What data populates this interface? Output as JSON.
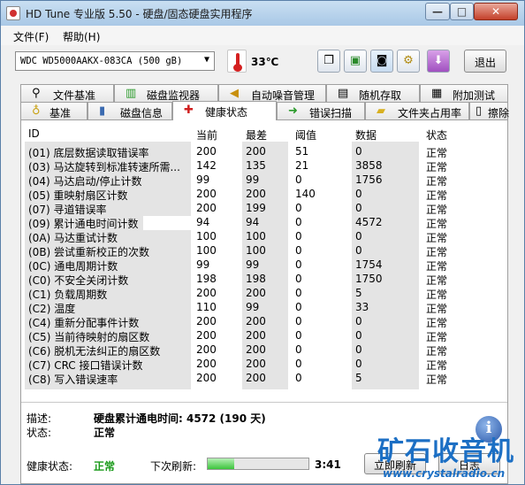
{
  "window": {
    "title": "HD Tune 专业版 5.50 - 硬盘/固态硬盘实用程序",
    "controls": {
      "minimize": "—",
      "maximize": "□",
      "close": "✕"
    }
  },
  "menu": {
    "file": "文件(F)",
    "help": "帮助(H)"
  },
  "toolbar": {
    "drive": "WDC WD5000AAKX-083CA (500 gB)",
    "temperature": "33℃",
    "exit_label": "退出",
    "icons": [
      "copy-text-icon",
      "copy-info-icon",
      "screenshot-camera-icon",
      "settings-tools-icon",
      "save-download-icon"
    ]
  },
  "tabs_top": [
    {
      "label": "文件基准",
      "icon": "file-benchmark-icon",
      "glyph": "⚲"
    },
    {
      "label": "磁盘监视器",
      "icon": "disk-monitor-icon",
      "glyph": "▥"
    },
    {
      "label": "自动噪音管理",
      "icon": "speaker-icon",
      "glyph": "◀"
    },
    {
      "label": "随机存取",
      "icon": "random-access-icon",
      "glyph": "▤"
    },
    {
      "label": "附加测试",
      "icon": "extra-tests-icon",
      "glyph": "▦"
    }
  ],
  "tabs_bottom": [
    {
      "label": "基准",
      "icon": "benchmark-icon",
      "glyph": "♁"
    },
    {
      "label": "磁盘信息",
      "icon": "disk-info-icon",
      "glyph": "▮"
    },
    {
      "label": "健康状态",
      "icon": "health-cross-icon",
      "glyph": "✚",
      "active": true
    },
    {
      "label": "错误扫描",
      "icon": "error-scan-icon",
      "glyph": "➜"
    },
    {
      "label": "文件夹占用率",
      "icon": "folder-usage-icon",
      "glyph": "▰"
    },
    {
      "label": "擦除",
      "icon": "erase-trash-icon",
      "glyph": "▯"
    }
  ],
  "table": {
    "headers": {
      "id": "ID",
      "current": "当前",
      "worst": "最差",
      "threshold": "阈值",
      "data": "数据",
      "status": "状态"
    },
    "rows": [
      {
        "id": "(01) 底层数据读取错误率",
        "current": "200",
        "worst": "200",
        "threshold": "51",
        "data": "0",
        "status": "正常"
      },
      {
        "id": "(03) 马达旋转到标准转速所需...",
        "current": "142",
        "worst": "135",
        "threshold": "21",
        "data": "3858",
        "status": "正常"
      },
      {
        "id": "(04) 马达启动/停止计数",
        "current": "99",
        "worst": "99",
        "threshold": "0",
        "data": "1756",
        "status": "正常"
      },
      {
        "id": "(05) 重映射扇区计数",
        "current": "200",
        "worst": "200",
        "threshold": "140",
        "data": "0",
        "status": "正常"
      },
      {
        "id": "(07) 寻道错误率",
        "current": "200",
        "worst": "199",
        "threshold": "0",
        "data": "0",
        "status": "正常"
      },
      {
        "id": "(09) 累计通电时间计数",
        "current": "94",
        "worst": "94",
        "threshold": "0",
        "data": "4572",
        "status": "正常"
      },
      {
        "id": "(0A) 马达重试计数",
        "current": "100",
        "worst": "100",
        "threshold": "0",
        "data": "0",
        "status": "正常"
      },
      {
        "id": "(0B) 尝试重新校正的次数",
        "current": "100",
        "worst": "100",
        "threshold": "0",
        "data": "0",
        "status": "正常"
      },
      {
        "id": "(0C) 通电周期计数",
        "current": "99",
        "worst": "99",
        "threshold": "0",
        "data": "1754",
        "status": "正常"
      },
      {
        "id": "(C0) 不安全关闭计数",
        "current": "198",
        "worst": "198",
        "threshold": "0",
        "data": "1750",
        "status": "正常"
      },
      {
        "id": "(C1) 负载周期数",
        "current": "200",
        "worst": "200",
        "threshold": "0",
        "data": "5",
        "status": "正常"
      },
      {
        "id": "(C2) 温度",
        "current": "110",
        "worst": "99",
        "threshold": "0",
        "data": "33",
        "status": "正常"
      },
      {
        "id": "(C4) 重新分配事件计数",
        "current": "200",
        "worst": "200",
        "threshold": "0",
        "data": "0",
        "status": "正常"
      },
      {
        "id": "(C5) 当前待映射的扇区数",
        "current": "200",
        "worst": "200",
        "threshold": "0",
        "data": "0",
        "status": "正常"
      },
      {
        "id": "(C6) 脱机无法纠正的扇区数",
        "current": "200",
        "worst": "200",
        "threshold": "0",
        "data": "0",
        "status": "正常"
      },
      {
        "id": "(C7) CRC 接口错误计数",
        "current": "200",
        "worst": "200",
        "threshold": "0",
        "data": "0",
        "status": "正常"
      },
      {
        "id": "(C8) 写入错误速率",
        "current": "200",
        "worst": "200",
        "threshold": "0",
        "data": "5",
        "status": "正常"
      }
    ]
  },
  "details": {
    "desc_label": "描述:",
    "desc_value": "硬盘累计通电时间: 4572 (190 天)",
    "status_label": "状态:",
    "status_value": "正常",
    "info_glyph": "i"
  },
  "footer": {
    "health_label": "健康状态:",
    "health_value": "正常",
    "health_color": "#1a9a1a",
    "refresh_label": "下次刷新:",
    "refresh_progress": 0.26,
    "countdown": "3:41",
    "refresh_button": "立即刷新",
    "log_button": "日志"
  },
  "watermark": {
    "brand": "矿石收音机",
    "url": "www.crystalradio.cn"
  }
}
